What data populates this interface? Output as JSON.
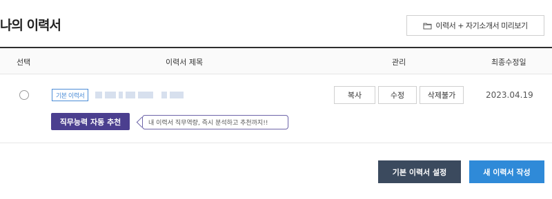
{
  "header": {
    "title": "나의 이력서",
    "preview_label": "이력서 + 자기소개서 미리보기",
    "preview_icon": "folder-icon"
  },
  "table": {
    "columns": [
      "선택",
      "이력서 제목",
      "관리",
      "최종수정일"
    ],
    "rows": [
      {
        "badge": "기본 이력서",
        "actions": [
          "복사",
          "수정",
          "삭제불가"
        ],
        "updated": "2023.04.19",
        "recommend_label": "직무능력 자동 추천",
        "tooltip": "내 이력서 직무역량, 즉시 분석하고 추천까지!!"
      }
    ]
  },
  "footer": {
    "set_default_label": "기본 이력서 설정",
    "new_resume_label": "새 이력서 작성"
  },
  "colors": {
    "accent_purple": "#4b3f8f",
    "accent_blue": "#2f8ad8",
    "dark_button": "#3b4a5e",
    "badge_blue": "#4a8bd6"
  }
}
